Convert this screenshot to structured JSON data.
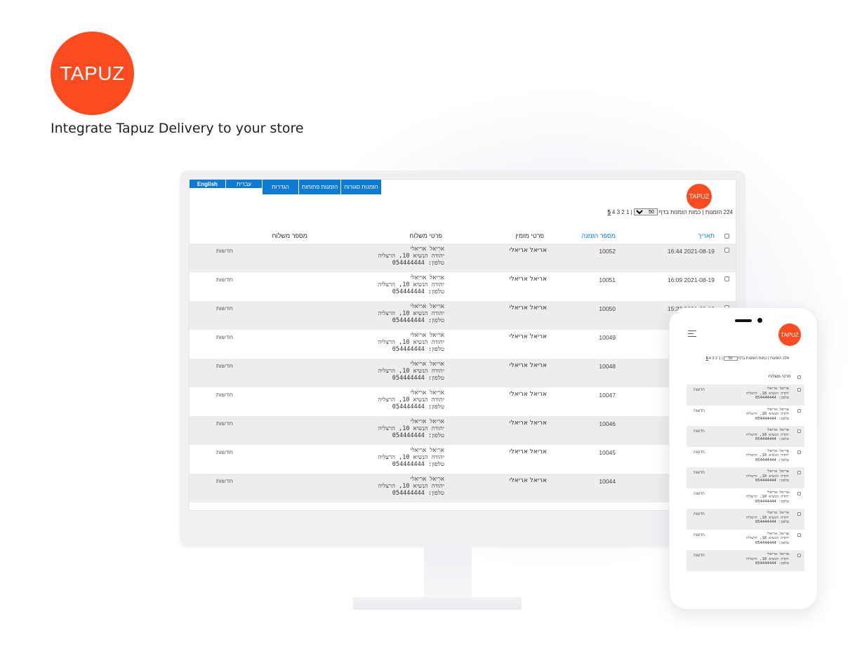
{
  "hero": {
    "logo_text": "TAPUZ",
    "tagline": "Integrate Tapuz Delivery to your store",
    "brand_color": "#fc4c1f"
  },
  "desktop": {
    "tabs": {
      "english": "English",
      "hebrew": "עברית",
      "settings": "הגדרות",
      "open_orders": "הזמנות פתוחות",
      "closed_orders": "הזמנות סגורות"
    },
    "logo_text": "TAPUZ",
    "pager": {
      "total_text": "224 הזמנות | כמות הזמנות בדף",
      "per_page": "50",
      "pages": "| 1 2 3 4",
      "current_page": "5"
    },
    "columns": {
      "date": "תאריך",
      "order_number": "מספר הזמנה",
      "customer": "פרטי מזמין",
      "shipment": "פרטי משלוח",
      "shipment_number": "מספר משלוח"
    },
    "rows": [
      {
        "date": "16:44 2021-08-19",
        "order": "10052",
        "customer": "אריאל אריאלי",
        "ship_name": "אריאל אריאלי",
        "ship_addr": "יהודה הנשיא 10, הרצליה",
        "ship_phone": "טלפון: 054444444",
        "status": "חדשות"
      },
      {
        "date": "16:09 2021-08-19",
        "order": "10051",
        "customer": "אריאל אריאלי",
        "ship_name": "אריאל אריאלי",
        "ship_addr": "יהודה הנשיא 10, הרצליה",
        "ship_phone": "טלפון: 054444444",
        "status": "חדשות"
      },
      {
        "date": "15:23 2021-08-19",
        "order": "10050",
        "customer": "אריאל אריאלי",
        "ship_name": "אריאל אריאלי",
        "ship_addr": "יהודה הנשיא 10, הרצליה",
        "ship_phone": "טלפון: 054444444",
        "status": "חדשות"
      },
      {
        "date": "",
        "order": "10049",
        "customer": "אריאל אריאלי",
        "ship_name": "אריאל אריאלי",
        "ship_addr": "יהודה הנשיא 10, הרצליה",
        "ship_phone": "טלפון: 054444444",
        "status": "חדשות"
      },
      {
        "date": "",
        "order": "10048",
        "customer": "אריאל אריאלי",
        "ship_name": "אריאל אריאלי",
        "ship_addr": "יהודה הנשיא 10, הרצליה",
        "ship_phone": "טלפון: 054444444",
        "status": "חדשות"
      },
      {
        "date": "",
        "order": "10047",
        "customer": "אריאל אריאלי",
        "ship_name": "אריאל אריאלי",
        "ship_addr": "יהודה הנשיא 10, הרצליה",
        "ship_phone": "טלפון: 054444444",
        "status": "חדשות"
      },
      {
        "date": "",
        "order": "10046",
        "customer": "אריאל אריאלי",
        "ship_name": "אריאל אריאלי",
        "ship_addr": "יהודה הנשיא 10, הרצליה",
        "ship_phone": "טלפון: 054444444",
        "status": "חדשות"
      },
      {
        "date": "",
        "order": "10045",
        "customer": "אריאל אריאלי",
        "ship_name": "אריאל אריאלי",
        "ship_addr": "יהודה הנשיא 10, הרצליה",
        "ship_phone": "טלפון: 054444444",
        "status": "חדשות"
      },
      {
        "date": "",
        "order": "10044",
        "customer": "אריאל אריאלי",
        "ship_name": "אריאל אריאלי",
        "ship_addr": "יהודה הנשיא 10, הרצליה",
        "ship_phone": "טלפון: 054444444",
        "status": "חדשות"
      }
    ]
  },
  "mobile": {
    "logo_text": "TAPUZ",
    "menu_icon": "hamburger-icon",
    "pager": {
      "total_text": "224 הזמנות | כמות הזמנות בדף",
      "per_page": "50",
      "pages": "| 1 2 3 4",
      "current_page": "5"
    },
    "column": "פרטי משלוח",
    "rows": [
      {
        "ship_name": "אריאל אריאלי",
        "ship_addr": "יהודה הנשיא 10, הרצליה",
        "ship_phone": "טלפון: 054444444",
        "status": "חדשות"
      },
      {
        "ship_name": "אריאל אריאלי",
        "ship_addr": "יהודה הנשיא 10, הרצליה",
        "ship_phone": "טלפון: 054444444",
        "status": "חדשות"
      },
      {
        "ship_name": "אריאל אריאלי",
        "ship_addr": "יהודה הנשיא 10, הרצליה",
        "ship_phone": "טלפון: 054444444",
        "status": "חדשות"
      },
      {
        "ship_name": "אריאל אריאלי",
        "ship_addr": "יהודה הנשיא 10, הרצליה",
        "ship_phone": "טלפון: 054444444",
        "status": "חדשות"
      },
      {
        "ship_name": "אריאל אריאלי",
        "ship_addr": "יהודה הנשיא 10, הרצליה",
        "ship_phone": "טלפון: 054444444",
        "status": "חדשות"
      },
      {
        "ship_name": "אריאל אריאלי",
        "ship_addr": "יהודה הנשיא 10, הרצליה",
        "ship_phone": "טלפון: 054444444",
        "status": "חדשות"
      },
      {
        "ship_name": "אריאל אריאלי",
        "ship_addr": "יהודה הנשיא 10, הרצליה",
        "ship_phone": "טלפון: 054444444",
        "status": "חדשות"
      },
      {
        "ship_name": "אריאל אריאלי",
        "ship_addr": "יהודה הנשיא 10, הרצליה",
        "ship_phone": "טלפון: 054444444",
        "status": "חדשות"
      },
      {
        "ship_name": "אריאל אריאלי",
        "ship_addr": "יהודה הנשיא 10, הרצליה",
        "ship_phone": "טלפון: 054444444",
        "status": "חדשות"
      }
    ]
  }
}
